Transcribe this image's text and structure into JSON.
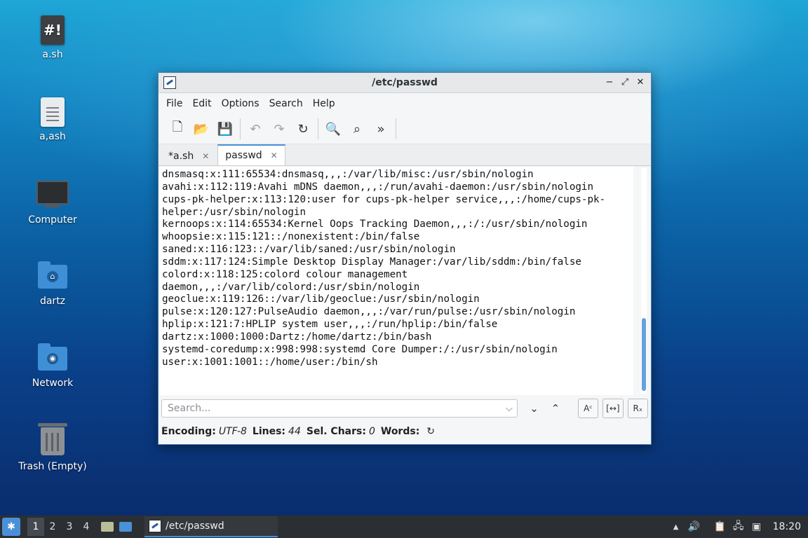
{
  "desktop": {
    "icons": [
      {
        "label": "a.sh",
        "icon": "script-file-icon"
      },
      {
        "label": "a,ash",
        "icon": "text-file-icon"
      },
      {
        "label": "Computer",
        "icon": "computer-icon"
      },
      {
        "label": "dartz",
        "icon": "home-folder-icon"
      },
      {
        "label": "Network",
        "icon": "network-folder-icon"
      },
      {
        "label": "Trash (Empty)",
        "icon": "trash-icon"
      }
    ],
    "script_glyph": "#!"
  },
  "window": {
    "title": "/etc/passwd",
    "controls": {
      "minimize": "−",
      "maximize": "⤢",
      "close": "✕"
    },
    "menu": [
      "File",
      "Edit",
      "Options",
      "Search",
      "Help"
    ],
    "toolbar": {
      "new": "🗋",
      "open": "📂",
      "save": "💾",
      "undo": "↶",
      "redo": "↷",
      "reload": "↻",
      "find": "🔍",
      "replace": "⌕",
      "more": "»"
    },
    "tabs": [
      {
        "label": "*a.sh",
        "close": "✕",
        "active": false
      },
      {
        "label": "passwd",
        "close": "✕",
        "active": true
      }
    ],
    "editor_text": "dnsmasq:x:111:65534:dnsmasq,,,:/var/lib/misc:/usr/sbin/nologin\navahi:x:112:119:Avahi mDNS daemon,,,:/run/avahi-daemon:/usr/sbin/nologin\ncups-pk-helper:x:113:120:user for cups-pk-helper service,,,:/home/cups-pk-helper:/usr/sbin/nologin\nkernoops:x:114:65534:Kernel Oops Tracking Daemon,,,:/:/usr/sbin/nologin\nwhoopsie:x:115:121::/nonexistent:/bin/false\nsaned:x:116:123::/var/lib/saned:/usr/sbin/nologin\nsddm:x:117:124:Simple Desktop Display Manager:/var/lib/sddm:/bin/false\ncolord:x:118:125:colord colour management daemon,,,:/var/lib/colord:/usr/sbin/nologin\ngeoclue:x:119:126::/var/lib/geoclue:/usr/sbin/nologin\npulse:x:120:127:PulseAudio daemon,,,:/var/run/pulse:/usr/sbin/nologin\nhplip:x:121:7:HPLIP system user,,,:/run/hplip:/bin/false\ndartz:x:1000:1000:Dartz:/home/dartz:/bin/bash\nsystemd-coredump:x:998:998:systemd Core Dumper:/:/usr/sbin/nologin\nuser:x:1001:1001::/home/user:/bin/sh",
    "findbar": {
      "placeholder": "Search...",
      "dropdown": "⌵",
      "prev": "⌄",
      "next": "⌃",
      "match_case": "Aᶜ",
      "whole_word": "[↔]",
      "regex": "Rₓ"
    },
    "status": {
      "encoding_label": "Encoding:",
      "encoding_value": "UTF-8",
      "lines_label": "Lines:",
      "lines_value": "44",
      "sel_label": "Sel. Chars:",
      "sel_value": "0",
      "words_label": "Words:",
      "words_refresh": "↻"
    }
  },
  "taskbar": {
    "start_glyph": "✱",
    "workspaces": [
      "1",
      "2",
      "3",
      "4"
    ],
    "task_label": "/etc/passwd",
    "clock": "18:20",
    "tray": {
      "up": "▲",
      "volume": "🔊",
      "clipboard": "📋",
      "network": "🖧",
      "display": "▣"
    }
  },
  "colors": {
    "accent": "#4a90d9",
    "taskbar": "#2b2f33"
  }
}
